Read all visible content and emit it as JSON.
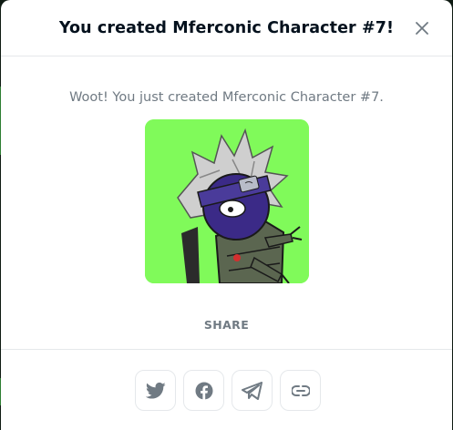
{
  "modal": {
    "title": "You created Mferconic Character #7!",
    "message": "Woot! You just created Mferconic Character #7.",
    "share_label": "SHARE",
    "image_alt": "Mferconic Character #7"
  },
  "icons": {
    "close": "close-icon",
    "twitter": "twitter-icon",
    "facebook": "facebook-icon",
    "telegram": "telegram-icon",
    "link": "link-icon"
  },
  "colors": {
    "image_background": "#80fa5a",
    "title": "#04111d",
    "muted_text": "#707a83",
    "icon": "#707a83",
    "border": "#e5e8eb"
  }
}
